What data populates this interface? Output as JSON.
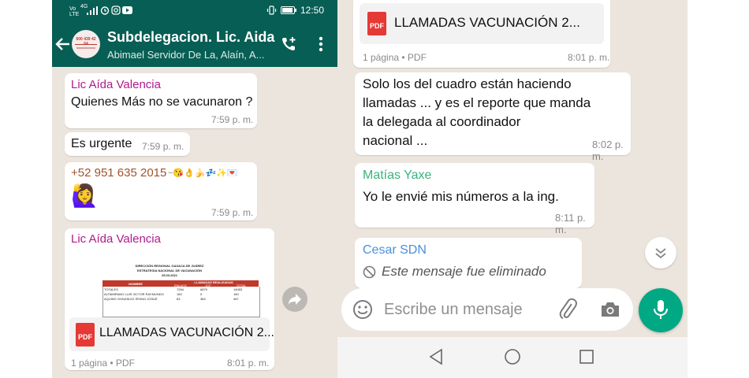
{
  "left": {
    "status": {
      "carrier": "Vo LTE",
      "signal": "4G",
      "time": "12:50"
    },
    "header": {
      "title": "Subdelegacion. Lic. Aida",
      "subtitle": "Abimael Servidor De La, Alaín, A...",
      "avatar_text": "600 439 42 64"
    },
    "messages": [
      {
        "sender": "Lic Aída Valencia",
        "text": "Quienes Más no se vacunaron ?",
        "time": "7:59 p. m."
      },
      {
        "text": "Es urgente",
        "time": "7:59 p. m."
      },
      {
        "sender": "+52 951 635 2015",
        "sender_extra": "~😘👌🍌💤✨💌",
        "emoji": "🙋‍♀️",
        "time": "7:59 p. m."
      },
      {
        "sender": "Lic Aída Valencia",
        "doc": {
          "title1": "DIRECCIÓN REGIONAL OAXACA DE JUÁREZ",
          "title2": "ESTRATEGIA NACIONAL DE VACUNACIÓN",
          "title3": "25.03.2021",
          "col_nombre": "NOMBRE",
          "col_group": "LLAMADAS REALIZADAS",
          "col_enlace": "ENLACE",
          "col_jcf": "JCF",
          "col_total": "TOTAL",
          "row1": [
            "TOTALES",
            "7264",
            "6879",
            "14083"
          ],
          "row2": [
            "ALTAMIRANO LUIS VICTOR RAYMUNDO",
            "160",
            "0",
            "160"
          ],
          "row3": [
            "AQUINO GONZÁLEZ IRVING JOSUÉ",
            "83",
            "384",
            "467"
          ]
        },
        "file_name": "LLAMADAS VACUNACIÓN 2...",
        "pdf_label": "PDF",
        "meta": "1 página • PDF",
        "time": "8:01 p. m."
      }
    ]
  },
  "right": {
    "top_file": {
      "file_name": "LLAMADAS VACUNACIÓN 2...",
      "pdf_label": "PDF",
      "meta": "1 página • PDF",
      "time": "8:01 p. m."
    },
    "messages": [
      {
        "lines": [
          "Solo los del cuadro están haciendo",
          "llamadas ... y es el reporte que manda",
          "la delegada al coordinador",
          "nacional ..."
        ],
        "time": "8:02 p. m."
      },
      {
        "sender": "Matías Yaxe",
        "text": "Yo le envié mis números a la ing.",
        "time": "8:11 p. m."
      },
      {
        "sender": "Cesar SDN",
        "text": "Este mensaje fue eliminado"
      }
    ],
    "input": {
      "placeholder": "Escribe un mensaje"
    }
  },
  "colors": {
    "header": "#075e54",
    "accent": "#00a884",
    "chat_bg": "#ece5dd",
    "sender_aida": "#b01a8a",
    "sender_phone": "#a0522d",
    "sender_matias": "#36b37e",
    "sender_cesar": "#4a90d9"
  },
  "icons": [
    "back-arrow-icon",
    "add-call-icon",
    "more-vert-icon",
    "forward-icon",
    "pdf-icon",
    "emoji-icon",
    "attach-icon",
    "camera-icon",
    "mic-icon",
    "scroll-down-icon",
    "deleted-icon",
    "nav-back-icon",
    "nav-home-icon",
    "nav-recents-icon"
  ]
}
